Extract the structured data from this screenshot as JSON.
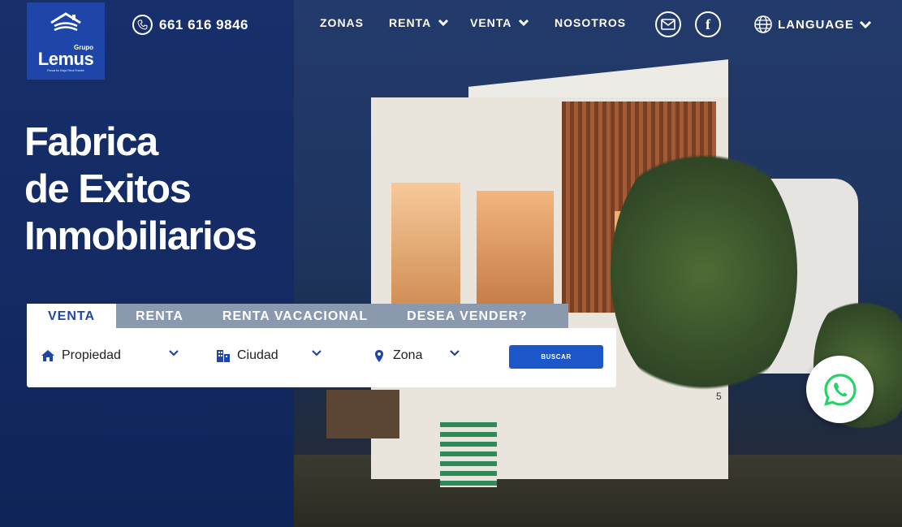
{
  "brand": {
    "grupo": "Grupo",
    "name": "Lemus",
    "tagline": "Rosarito Baja Real Estate"
  },
  "phone": {
    "number": "661 616 9846",
    "icon": "phone-icon"
  },
  "nav": {
    "zonas": "ZONAS",
    "renta": "RENTA",
    "venta": "VENTA",
    "nosotros": "NOSOTROS"
  },
  "social": {
    "mail_icon": "mail-icon",
    "facebook_icon": "facebook-icon",
    "facebook_glyph": "f"
  },
  "language": {
    "label": "LANGUAGE",
    "icon": "globe-icon"
  },
  "hero": {
    "line1": "Fabrica",
    "line2": "de Exitos",
    "line3": "Inmobiliarios",
    "house_number": "5"
  },
  "search": {
    "tabs": [
      "VENTA",
      "RENTA",
      "RENTA VACACIONAL",
      "DESEA VENDER?"
    ],
    "active_tab": "VENTA",
    "fields": {
      "propiedad": "Propiedad",
      "ciudad": "Ciudad",
      "zona": "Zona"
    },
    "button": "BUSCAR"
  },
  "colors": {
    "primary": "#1e46a8",
    "button": "#1b57c9",
    "whatsapp": "#25d366",
    "tab_inactive": "#8a99ae"
  }
}
